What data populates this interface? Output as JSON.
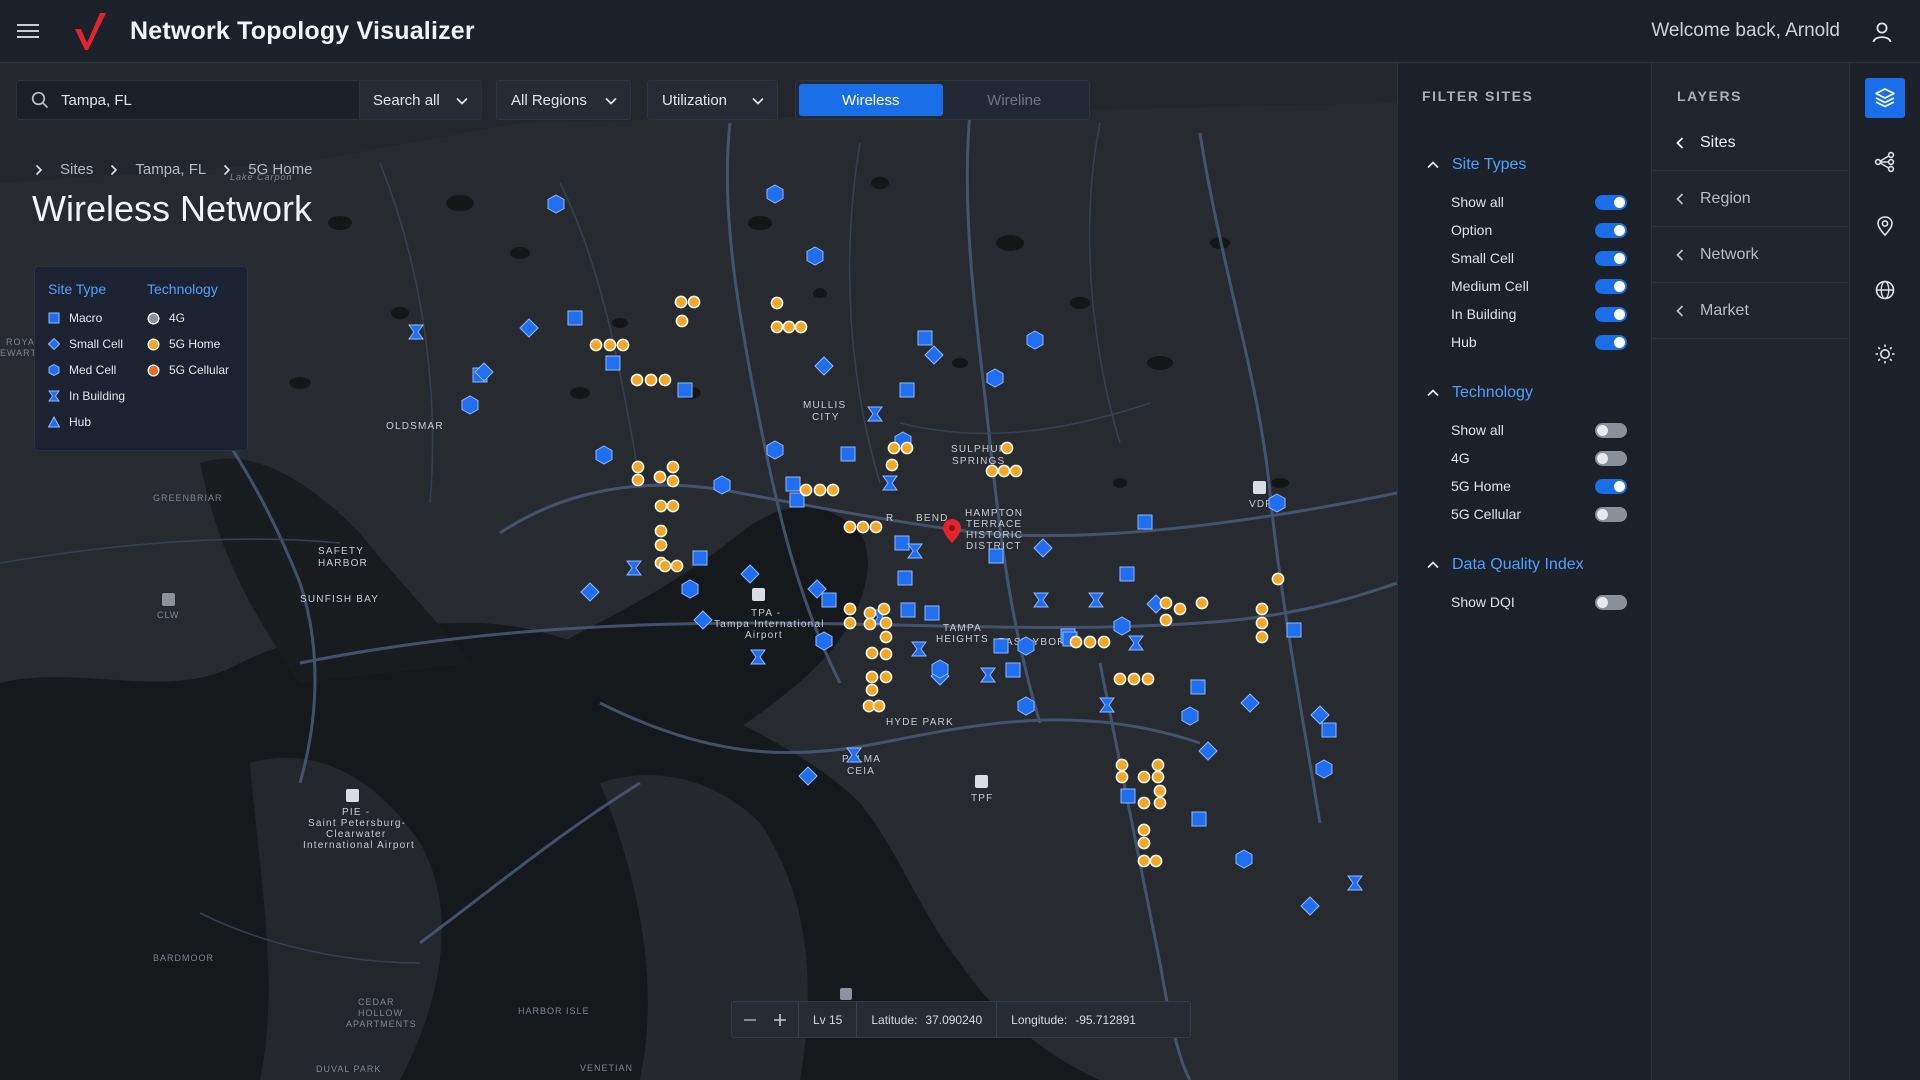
{
  "app": {
    "title": "Network Topology Visualizer",
    "welcome": "Welcome back, Arnold",
    "accent": "#1a6fe8",
    "brand_color": "#e3242b"
  },
  "search": {
    "value": "Tampa, FL",
    "scope": "Search all"
  },
  "filters": {
    "region": "All Regions",
    "metric": "Utilization"
  },
  "network_toggle": {
    "options": [
      "Wireless",
      "Wireline"
    ],
    "selected": "Wireless"
  },
  "breadcrumb": [
    "Sites",
    "Tampa, FL",
    "5G Home"
  ],
  "page_title": "Wireless Network",
  "legend": {
    "site_type_title": "Site Type",
    "technology_title": "Technology",
    "site_types": [
      "Macro",
      "Small Cell",
      "Med Cell",
      "In Building",
      "Hub"
    ],
    "technologies": [
      "4G",
      "5G Home",
      "5G Cellular"
    ]
  },
  "map_labels": {
    "places": [
      "OLDSMAR",
      "SAFETY",
      "HARBOR",
      "SUNFISH BAY",
      "MULLIS",
      "CITY",
      "SULPHUR",
      "SPRINGS",
      "HAMPTON",
      "TERRACE",
      "HISTORIC",
      "DISTRICT",
      "R",
      "BEND",
      "TAMPA",
      "HEIGHTS",
      "EAST YBOR",
      "HYDE PARK",
      "PALMA",
      "CEIA"
    ],
    "dim_places": [
      "GREENBRIAR",
      "BARDMOOR",
      "HARBOR ISLE",
      "CEDAR",
      "HOLLOW",
      "APARTMENTS",
      "DUVAL PARK",
      "VENETIAN",
      "ROYA",
      "EWART",
      "Lake Carpon"
    ],
    "airports": [
      {
        "code": "TPA -",
        "name": "Tampa International",
        "sub": "Airport"
      },
      {
        "code": "PIE -",
        "name": "Saint Petersburg-",
        "sub": "Clearwater",
        "sub2": "International Airport"
      },
      {
        "code": "TPF"
      },
      {
        "code": "VDF"
      },
      {
        "code": "CLW"
      }
    ]
  },
  "status": {
    "zoom": "Lv 15",
    "latitude_label": "Latitude:",
    "latitude": "37.090240",
    "longitude_label": "Longitude:",
    "longitude": "-95.712891"
  },
  "filter_panel": {
    "title": "FILTER SITES",
    "sections": [
      {
        "title": "Site Types",
        "items": [
          {
            "label": "Show all",
            "on": true
          },
          {
            "label": "Option",
            "on": true
          },
          {
            "label": "Small Cell",
            "on": true
          },
          {
            "label": "Medium Cell",
            "on": true
          },
          {
            "label": "In Building",
            "on": true
          },
          {
            "label": "Hub",
            "on": true
          }
        ]
      },
      {
        "title": "Technology",
        "items": [
          {
            "label": "Show all",
            "on": false
          },
          {
            "label": "4G",
            "on": false
          },
          {
            "label": "5G Home",
            "on": true
          },
          {
            "label": "5G Cellular",
            "on": false
          }
        ]
      },
      {
        "title": "Data Quality Index",
        "items": [
          {
            "label": "Show DQI",
            "on": false
          }
        ]
      }
    ]
  },
  "layers_panel": {
    "title": "LAYERS",
    "items": [
      "Sites",
      "Region",
      "Network",
      "Market"
    ],
    "active": "Sites"
  },
  "rail_icons": [
    "layers-icon",
    "topology-icon",
    "location-pin-icon",
    "globe-icon",
    "sun-icon"
  ]
}
